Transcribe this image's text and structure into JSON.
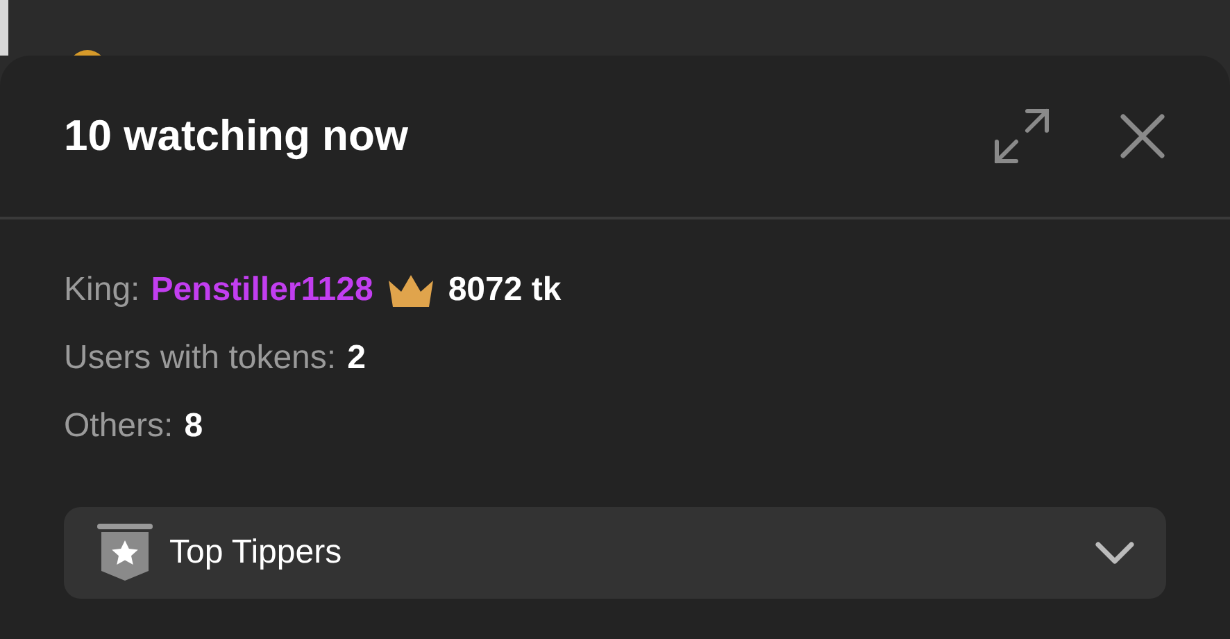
{
  "panel": {
    "title": "10 watching now"
  },
  "stats": [
    {
      "kind": "king",
      "label": "King:",
      "user": "Penstiller1128",
      "value": "8072 tk"
    },
    {
      "kind": "plain",
      "label": "Users with tokens:",
      "value": "2"
    },
    {
      "kind": "plain",
      "label": "Others:",
      "value": "8"
    }
  ],
  "dropdown": {
    "label": "Top Tippers",
    "expanded": false
  }
}
